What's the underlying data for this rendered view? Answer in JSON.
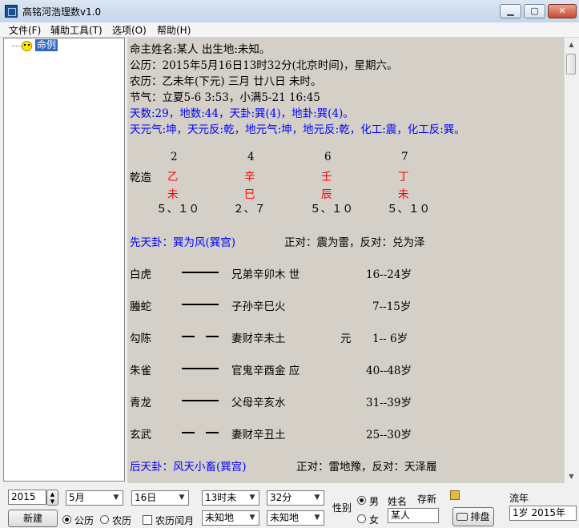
{
  "window": {
    "title": "高铭河浩理数v1.0"
  },
  "menu": [
    "文件(F)",
    "辅助工具(T)",
    "选项(O)",
    "帮助(H)"
  ],
  "tree": {
    "item": "命例"
  },
  "info": {
    "line1": "命主姓名:某人  出生地:未知。",
    "line2": "公历：2015年5月16日13时32分(北京时间)，星期六。",
    "line3": "农历：乙未年(下元) 三月 廿八日 未时。",
    "line4": "节气：立夏5-6 3:53，小满5-21 16:45",
    "line5": "天数:29，地数:44，天卦:巽(4)，地卦:巽(4)。",
    "line6": "天元气:坤，天元反:乾，地元气:坤，地元反:乾，化工:震，化工反:巽。"
  },
  "bazi": {
    "label": "乾造",
    "numbers": [
      "2",
      "4",
      "6",
      "7"
    ],
    "stems": [
      "乙",
      "辛",
      "壬",
      "丁"
    ],
    "branches": [
      "未",
      "巳",
      "辰",
      "未"
    ],
    "pairs": [
      "５、１０",
      "２、７",
      "５、１０",
      "５、１０"
    ]
  },
  "pre_gua": {
    "title": "先天卦：巽为风(巽宫)",
    "side": "正对：震为雷，反对：兑为泽"
  },
  "yao": [
    {
      "god": "白虎",
      "solid": true,
      "text": "兄弟辛卯木 世",
      "mark": "",
      "age": "16--24岁"
    },
    {
      "god": "螣蛇",
      "solid": true,
      "text": "子孙辛巳火",
      "mark": "",
      "age": "7--15岁"
    },
    {
      "god": "勾陈",
      "solid": false,
      "text": "妻财辛未土",
      "mark": "元",
      "age": "1-- 6岁"
    },
    {
      "god": "朱雀",
      "solid": true,
      "text": "官鬼辛酉金 应",
      "mark": "",
      "age": "40--48岁"
    },
    {
      "god": "青龙",
      "solid": true,
      "text": "父母辛亥水",
      "mark": "",
      "age": "31--39岁"
    },
    {
      "god": "玄武",
      "solid": false,
      "text": "妻财辛丑土",
      "mark": "",
      "age": "25--30岁"
    }
  ],
  "post_gua": {
    "title": "后天卦：风天小畜(巽宫)",
    "side": "正对：雷地豫，反对：天泽履"
  },
  "form": {
    "year": "2015",
    "month": "5月",
    "day": "16日",
    "hour": "13时未",
    "minute": "32分",
    "place1": "未知地",
    "place2": "未知地",
    "new_btn": "新建",
    "gongli": "公历",
    "nongli": "农历",
    "runyue": "农历闰月",
    "sex_label": "性别",
    "male": "男",
    "female": "女",
    "name_label": "姓名",
    "name_value": "某人",
    "save_label": "存新",
    "paipan": "排盘",
    "liunian_label": "流年",
    "liunian_value": "1岁  2015年"
  }
}
